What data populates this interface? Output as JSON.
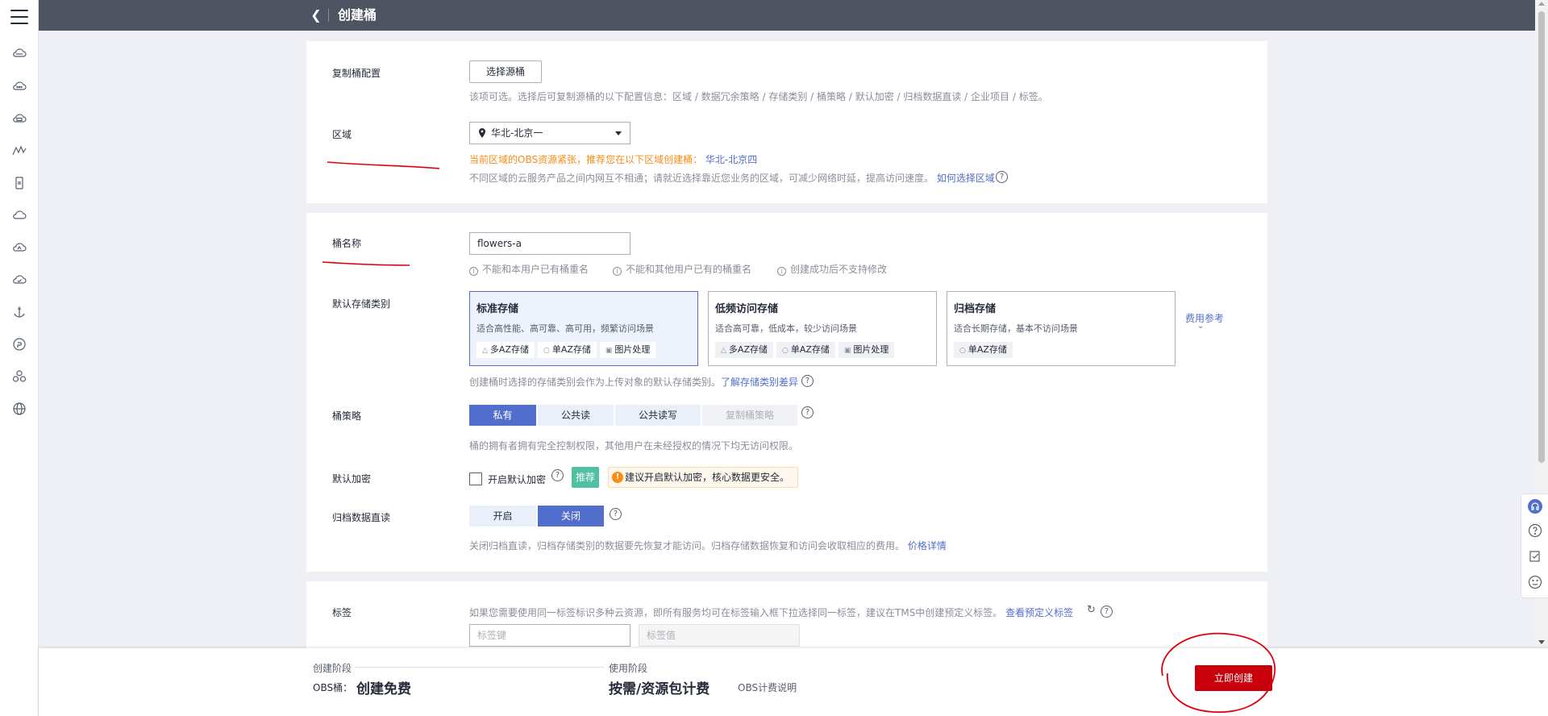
{
  "header": {
    "back_icon": "chevron-left-icon",
    "title": "创建桶"
  },
  "rail": {
    "icons": [
      "menu-icon",
      "cloud-icon",
      "cloud-more-icon",
      "cloud-box-icon",
      "mountain-icon",
      "phone-icon",
      "cloud-outline-icon",
      "cloud-drive-icon",
      "cloud-check-icon",
      "anchor-icon",
      "badge-icon",
      "cluster-icon",
      "globe-icon"
    ]
  },
  "replicate": {
    "label": "复制桶配置",
    "button": "选择源桶",
    "hint": "该项可选。选择后可复制源桶的以下配置信息：区域 / 数据冗余策略 / 存储类别 / 桶策略 / 默认加密 / 归档数据直读 / 企业项目 / 标签。"
  },
  "region": {
    "label": "区域",
    "value": "华北-北京一",
    "warning_prefix": "当前区域的OBS资源紧张，推荐您在以下区域创建桶：",
    "warning_link": "华北-北京四",
    "hint": "不同区域的云服务产品之间内网互不相通；请就近选择靠近您业务的区域，可减少网络时延，提高访问速度。",
    "hint_link": "如何选择区域"
  },
  "bucket_name": {
    "label": "桶名称",
    "value": "flowers-a",
    "rules": [
      "不能和本用户已有桶重名",
      "不能和其他用户已有的桶重名",
      "创建成功后不支持修改"
    ]
  },
  "storage_class": {
    "label": "默认存储类别",
    "options": [
      {
        "title": "标准存储",
        "desc": "适合高性能、高可靠、高可用，频繁访问场景",
        "tags": [
          "多AZ存储",
          "单AZ存储",
          "图片处理"
        ],
        "selected": true
      },
      {
        "title": "低频访问存储",
        "desc": "适合高可靠，低成本，较少访问场景",
        "tags": [
          "多AZ存储",
          "单AZ存储",
          "图片处理"
        ],
        "selected": false
      },
      {
        "title": "归档存储",
        "desc": "适合长期存储，基本不访问场景",
        "tags": [
          "单AZ存储"
        ],
        "selected": false
      }
    ],
    "fee_link": "费用参考",
    "hint": "创建桶时选择的存储类别会作为上传对象的默认存储类别。",
    "hint_link": "了解存储类别差异"
  },
  "policy": {
    "label": "桶策略",
    "options": [
      "私有",
      "公共读",
      "公共读写",
      "复制桶策略"
    ],
    "selected": "私有",
    "hint": "桶的拥有者拥有完全控制权限，其他用户在未经授权的情况下均无访问权限。"
  },
  "encryption": {
    "label": "默认加密",
    "checkbox_label": "开启默认加密",
    "badge": "推荐",
    "tip": "建议开启默认加密，核心数据更安全。"
  },
  "archive": {
    "label": "归档数据直读",
    "options": [
      "开启",
      "关闭"
    ],
    "selected": "关闭",
    "hint": "关闭归档直读，归档存储类别的数据要先恢复才能访问。归档存储数据恢复和访问会收取相应的费用。",
    "hint_link": "价格详情"
  },
  "tags": {
    "label": "标签",
    "hint": "如果您需要使用同一标签标识多种云资源，即所有服务均可在标签输入框下拉选择同一标签，建议在TMS中创建预定义标签。",
    "hint_link": "查看预定义标签",
    "key_placeholder": "标签键",
    "value_placeholder": "标签值"
  },
  "footer": {
    "create_stage": "创建阶段",
    "bucket_label": "OBS桶：",
    "create_fee": "创建免费",
    "use_stage": "使用阶段",
    "use_fee": "按需/资源包计费",
    "billing_link": "OBS计费说明",
    "create_button": "立即创建"
  },
  "colors": {
    "topbar": "#4e5461",
    "primary": "#526ecc",
    "danger": "#c7000b",
    "annotation": "#e0000d"
  }
}
